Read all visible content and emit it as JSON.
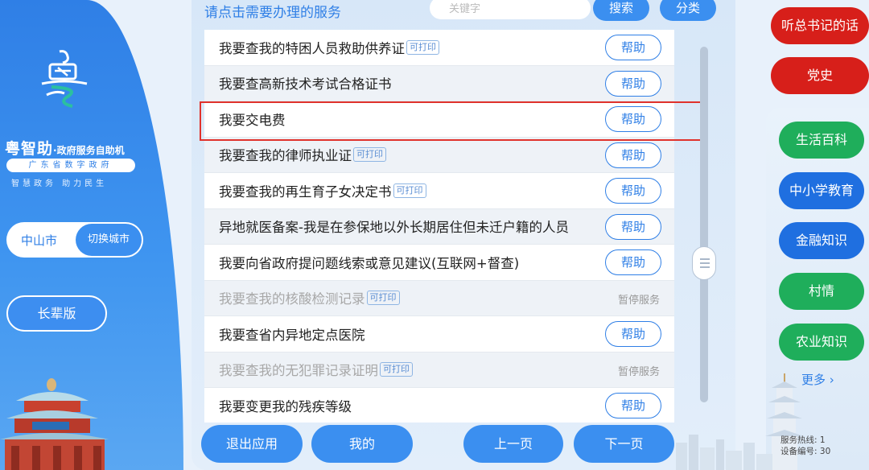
{
  "header": {
    "title": "请点击需要办理的服务",
    "search_placeholder": "关键字",
    "search_label": "搜索",
    "category_label": "分类"
  },
  "brand": {
    "name": "粤智助",
    "subtitle": "·政府服务自助机",
    "org": "广东省数字政府",
    "slogan": "智慧政务 助力民生"
  },
  "city": {
    "current": "中山市",
    "switch_label": "切换城市"
  },
  "elder_mode_label": "长辈版",
  "print_tag": "可打印",
  "help_label": "帮助",
  "suspended_label": "暂停服务",
  "services": [
    {
      "label": "我要查我的特困人员救助供养证",
      "printable": true,
      "status": "help"
    },
    {
      "label": "我要查高新技术考试合格证书",
      "printable": false,
      "status": "help"
    },
    {
      "label": "我要交电费",
      "printable": false,
      "status": "help",
      "highlighted": true
    },
    {
      "label": "我要查我的律师执业证",
      "printable": true,
      "status": "help"
    },
    {
      "label": "我要查我的再生育子女决定书",
      "printable": true,
      "status": "help"
    },
    {
      "label": "异地就医备案-我是在参保地以外长期居住但未迁户籍的人员",
      "printable": false,
      "status": "help"
    },
    {
      "label": "我要向省政府提问题线索或意见建议(互联网+督查)",
      "printable": false,
      "status": "help"
    },
    {
      "label": "我要查我的核酸检测记录",
      "printable": true,
      "status": "suspended"
    },
    {
      "label": "我要查省内异地定点医院",
      "printable": false,
      "status": "help"
    },
    {
      "label": "我要查我的无犯罪记录证明",
      "printable": true,
      "status": "suspended"
    },
    {
      "label": "我要变更我的残疾等级",
      "printable": false,
      "status": "help"
    }
  ],
  "footer": {
    "exit_label": "退出应用",
    "mine_label": "我的",
    "prev_label": "上一页",
    "next_label": "下一页"
  },
  "sidebar": {
    "speech_label": "听总书记的话",
    "party_label": "党史",
    "items": [
      {
        "label": "生活百科",
        "color": "#1fae5b"
      },
      {
        "label": "中小学教育",
        "color": "#1f6fe0"
      },
      {
        "label": "金融知识",
        "color": "#1f6fe0"
      },
      {
        "label": "村情",
        "color": "#1fae5b"
      },
      {
        "label": "农业知识",
        "color": "#1fae5b"
      }
    ],
    "more_label": "更多 ›"
  },
  "device_info": {
    "hotline_label": "服务热线:",
    "hotline_value": "1",
    "device_label": "设备编号:",
    "device_value": "30"
  },
  "colors": {
    "primary": "#3b8ff0",
    "red": "#d71f1a",
    "green": "#1fae5b",
    "highlight": "#e0322c"
  }
}
